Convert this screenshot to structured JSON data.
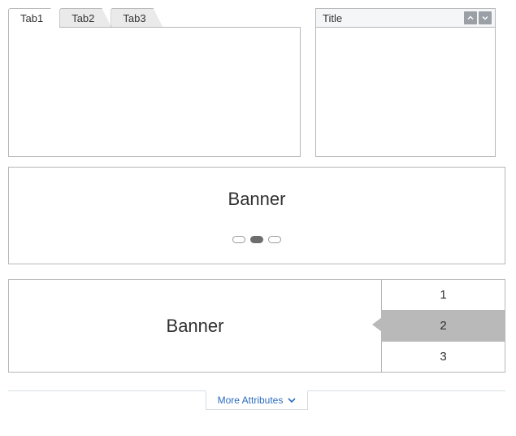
{
  "tabs": {
    "items": [
      {
        "label": "Tab1"
      },
      {
        "label": "Tab2"
      },
      {
        "label": "Tab3"
      }
    ]
  },
  "panel": {
    "title": "Title"
  },
  "banner1": {
    "text": "Banner",
    "dots": [
      "1",
      "2",
      "3"
    ],
    "active_index": 1
  },
  "banner2": {
    "text": "Banner",
    "items": [
      {
        "label": "1"
      },
      {
        "label": "2"
      },
      {
        "label": "3"
      }
    ],
    "active_index": 1
  },
  "footer": {
    "more_label": "More Attributes"
  }
}
